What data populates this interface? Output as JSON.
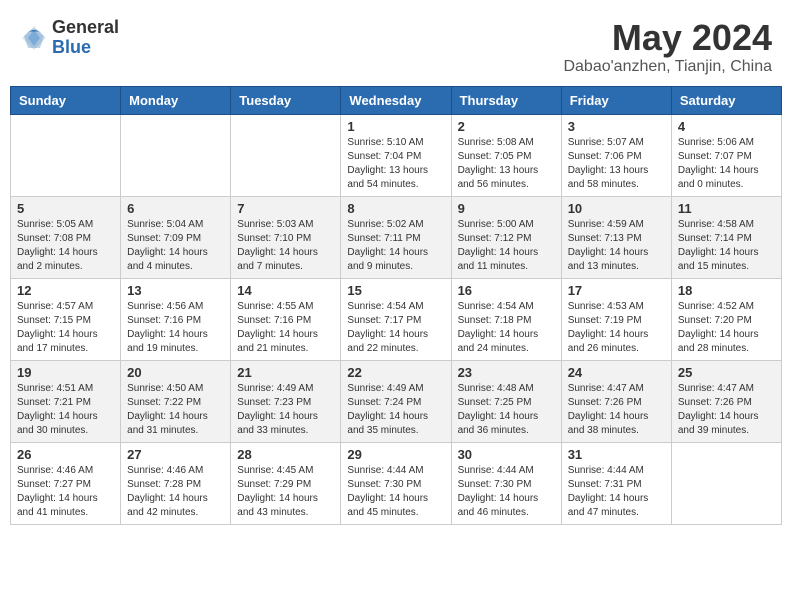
{
  "header": {
    "logo_general": "General",
    "logo_blue": "Blue",
    "month_title": "May 2024",
    "subtitle": "Dabao'anzhen, Tianjin, China"
  },
  "weekdays": [
    "Sunday",
    "Monday",
    "Tuesday",
    "Wednesday",
    "Thursday",
    "Friday",
    "Saturday"
  ],
  "weeks": [
    [
      {
        "day": "",
        "info": ""
      },
      {
        "day": "",
        "info": ""
      },
      {
        "day": "",
        "info": ""
      },
      {
        "day": "1",
        "info": "Sunrise: 5:10 AM\nSunset: 7:04 PM\nDaylight: 13 hours and 54 minutes."
      },
      {
        "day": "2",
        "info": "Sunrise: 5:08 AM\nSunset: 7:05 PM\nDaylight: 13 hours and 56 minutes."
      },
      {
        "day": "3",
        "info": "Sunrise: 5:07 AM\nSunset: 7:06 PM\nDaylight: 13 hours and 58 minutes."
      },
      {
        "day": "4",
        "info": "Sunrise: 5:06 AM\nSunset: 7:07 PM\nDaylight: 14 hours and 0 minutes."
      }
    ],
    [
      {
        "day": "5",
        "info": "Sunrise: 5:05 AM\nSunset: 7:08 PM\nDaylight: 14 hours and 2 minutes."
      },
      {
        "day": "6",
        "info": "Sunrise: 5:04 AM\nSunset: 7:09 PM\nDaylight: 14 hours and 4 minutes."
      },
      {
        "day": "7",
        "info": "Sunrise: 5:03 AM\nSunset: 7:10 PM\nDaylight: 14 hours and 7 minutes."
      },
      {
        "day": "8",
        "info": "Sunrise: 5:02 AM\nSunset: 7:11 PM\nDaylight: 14 hours and 9 minutes."
      },
      {
        "day": "9",
        "info": "Sunrise: 5:00 AM\nSunset: 7:12 PM\nDaylight: 14 hours and 11 minutes."
      },
      {
        "day": "10",
        "info": "Sunrise: 4:59 AM\nSunset: 7:13 PM\nDaylight: 14 hours and 13 minutes."
      },
      {
        "day": "11",
        "info": "Sunrise: 4:58 AM\nSunset: 7:14 PM\nDaylight: 14 hours and 15 minutes."
      }
    ],
    [
      {
        "day": "12",
        "info": "Sunrise: 4:57 AM\nSunset: 7:15 PM\nDaylight: 14 hours and 17 minutes."
      },
      {
        "day": "13",
        "info": "Sunrise: 4:56 AM\nSunset: 7:16 PM\nDaylight: 14 hours and 19 minutes."
      },
      {
        "day": "14",
        "info": "Sunrise: 4:55 AM\nSunset: 7:16 PM\nDaylight: 14 hours and 21 minutes."
      },
      {
        "day": "15",
        "info": "Sunrise: 4:54 AM\nSunset: 7:17 PM\nDaylight: 14 hours and 22 minutes."
      },
      {
        "day": "16",
        "info": "Sunrise: 4:54 AM\nSunset: 7:18 PM\nDaylight: 14 hours and 24 minutes."
      },
      {
        "day": "17",
        "info": "Sunrise: 4:53 AM\nSunset: 7:19 PM\nDaylight: 14 hours and 26 minutes."
      },
      {
        "day": "18",
        "info": "Sunrise: 4:52 AM\nSunset: 7:20 PM\nDaylight: 14 hours and 28 minutes."
      }
    ],
    [
      {
        "day": "19",
        "info": "Sunrise: 4:51 AM\nSunset: 7:21 PM\nDaylight: 14 hours and 30 minutes."
      },
      {
        "day": "20",
        "info": "Sunrise: 4:50 AM\nSunset: 7:22 PM\nDaylight: 14 hours and 31 minutes."
      },
      {
        "day": "21",
        "info": "Sunrise: 4:49 AM\nSunset: 7:23 PM\nDaylight: 14 hours and 33 minutes."
      },
      {
        "day": "22",
        "info": "Sunrise: 4:49 AM\nSunset: 7:24 PM\nDaylight: 14 hours and 35 minutes."
      },
      {
        "day": "23",
        "info": "Sunrise: 4:48 AM\nSunset: 7:25 PM\nDaylight: 14 hours and 36 minutes."
      },
      {
        "day": "24",
        "info": "Sunrise: 4:47 AM\nSunset: 7:26 PM\nDaylight: 14 hours and 38 minutes."
      },
      {
        "day": "25",
        "info": "Sunrise: 4:47 AM\nSunset: 7:26 PM\nDaylight: 14 hours and 39 minutes."
      }
    ],
    [
      {
        "day": "26",
        "info": "Sunrise: 4:46 AM\nSunset: 7:27 PM\nDaylight: 14 hours and 41 minutes."
      },
      {
        "day": "27",
        "info": "Sunrise: 4:46 AM\nSunset: 7:28 PM\nDaylight: 14 hours and 42 minutes."
      },
      {
        "day": "28",
        "info": "Sunrise: 4:45 AM\nSunset: 7:29 PM\nDaylight: 14 hours and 43 minutes."
      },
      {
        "day": "29",
        "info": "Sunrise: 4:44 AM\nSunset: 7:30 PM\nDaylight: 14 hours and 45 minutes."
      },
      {
        "day": "30",
        "info": "Sunrise: 4:44 AM\nSunset: 7:30 PM\nDaylight: 14 hours and 46 minutes."
      },
      {
        "day": "31",
        "info": "Sunrise: 4:44 AM\nSunset: 7:31 PM\nDaylight: 14 hours and 47 minutes."
      },
      {
        "day": "",
        "info": ""
      }
    ]
  ]
}
